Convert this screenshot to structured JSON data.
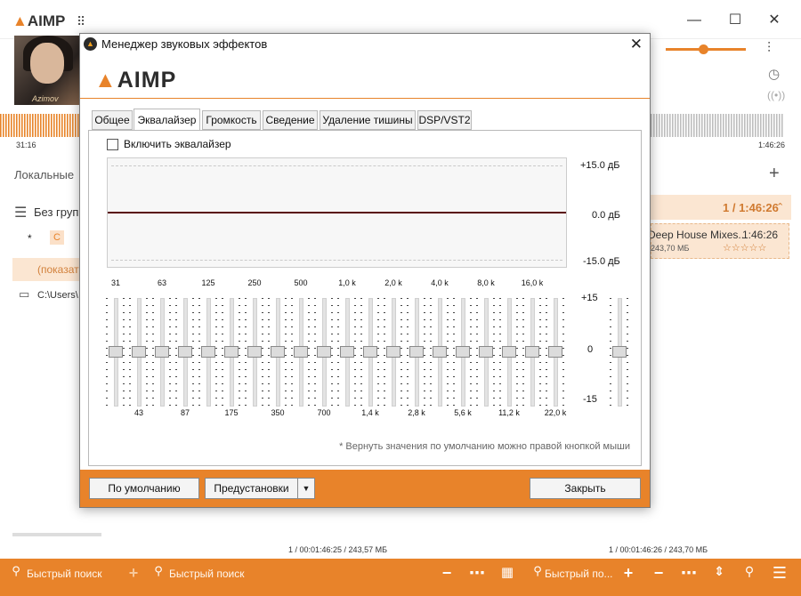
{
  "app": {
    "logo": "AIMP",
    "window_controls": {
      "minimize": "—",
      "maximize": "☐",
      "close": "✕"
    },
    "time_left": "31:16",
    "time_right": "1:46:26",
    "sidebar": {
      "local": "Локальные",
      "group": "Без груп",
      "star": "*",
      "c_badge": "С",
      "show": "(показат",
      "path": "C:\\Users\\"
    },
    "playlist": {
      "header": "1 / 1:46:26",
      "track_title": "Deep House Mixes...",
      "track_duration": "1:46:26",
      "track_size": "243,70 МБ",
      "rating_stars": "☆☆☆☆☆",
      "footer_left": "1 / 00:01:46:25 / 243,57 МБ",
      "footer_right": "1 / 00:01:46:26 / 243,70 МБ"
    },
    "statusbar": {
      "search1": "Быстрый поиск",
      "search2": "Быстрый поиск",
      "search3": "Быстрый по..."
    },
    "volume_level": 0.8
  },
  "dialog": {
    "title": "Менеджер звуковых эффектов",
    "brand": "AIMP",
    "tabs": [
      "Общее",
      "Эквалайзер",
      "Громкость",
      "Сведение",
      "Удаление тишины",
      "DSP/VST2"
    ],
    "active_tab": 1,
    "enable_label": "Включить эквалайзер",
    "db_labels": [
      "+15.0 дБ",
      "0.0 дБ",
      "-15.0 дБ"
    ],
    "freq_top": [
      "31",
      "63",
      "125",
      "250",
      "500",
      "1,0 k",
      "2,0 k",
      "4,0 k",
      "8,0 k",
      "16,0 k"
    ],
    "freq_bottom": [
      "43",
      "87",
      "175",
      "350",
      "700",
      "1,4 k",
      "2,8 k",
      "5,6 k",
      "11,2 k",
      "22,0 k"
    ],
    "range_labels": [
      "+15",
      "0",
      "-15"
    ],
    "band_gains_db": [
      0,
      0,
      0,
      0,
      0,
      0,
      0,
      0,
      0,
      0,
      0,
      0,
      0,
      0,
      0,
      0,
      0,
      0,
      0,
      0
    ],
    "preamp_db": 0,
    "hint": "* Вернуть значения по умолчанию можно правой кнопкой мыши",
    "buttons": {
      "default": "По умолчанию",
      "presets": "Предустановки",
      "close": "Закрыть"
    }
  }
}
